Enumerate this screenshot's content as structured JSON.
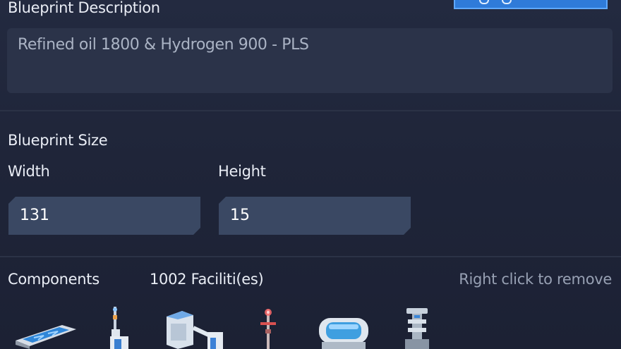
{
  "description_section": {
    "label": "Blueprint  Description",
    "value": "Refined oil 1800 & Hydrogen 900 - PLS"
  },
  "size_section": {
    "label": "Blueprint Size",
    "width_label": "Width",
    "width_value": "131",
    "height_label": "Height",
    "height_value": "15"
  },
  "components_section": {
    "label": "Components",
    "count_text": "1002 Faciliti(es)",
    "hint": "Right click to remove",
    "items": [
      {
        "icon": "conveyor-belt-icon"
      },
      {
        "icon": "sorter-icon"
      },
      {
        "icon": "assembler-icon"
      },
      {
        "icon": "power-pole-icon"
      },
      {
        "icon": "storage-tank-icon"
      },
      {
        "icon": "logistics-station-icon"
      }
    ]
  },
  "colors": {
    "background": "#1f2438",
    "field": "#3a4863",
    "text_box": "#2b3349",
    "accent": "#2f7bd9"
  }
}
